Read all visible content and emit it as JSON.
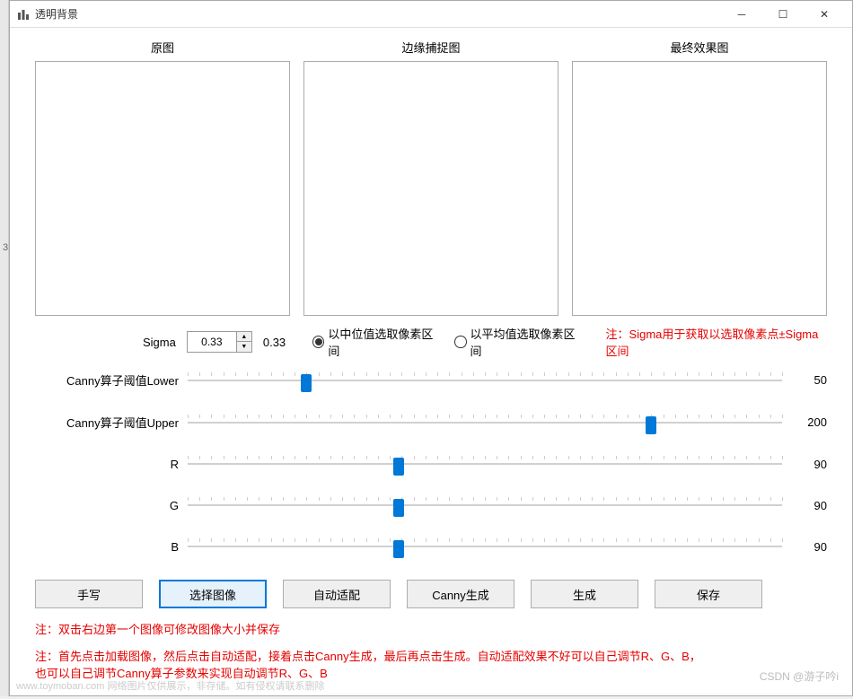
{
  "titlebar": {
    "title": "透明背景"
  },
  "left_strip": {
    "value": "3"
  },
  "images": {
    "original": "原图",
    "edge": "边缘捕捉图",
    "result": "最终效果图"
  },
  "sigma": {
    "label": "Sigma",
    "input_value": "0.33",
    "display_value": "0.33",
    "radio_median": "以中位值选取像素区间",
    "radio_mean": "以平均值选取像素区间",
    "note": "注：Sigma用于获取以选取像素点±Sigma区间"
  },
  "sliders": {
    "lower": {
      "label": "Canny算子阈值Lower",
      "value": "50",
      "pos_pct": 20
    },
    "upper": {
      "label": "Canny算子阈值Upper",
      "value": "200",
      "pos_pct": 78
    },
    "r": {
      "label": "R",
      "value": "90",
      "pos_pct": 35.5
    },
    "g": {
      "label": "G",
      "value": "90",
      "pos_pct": 35.5
    },
    "b": {
      "label": "B",
      "value": "90",
      "pos_pct": 35.5
    }
  },
  "buttons": {
    "handwrite": "手写",
    "select_image": "选择图像",
    "auto_fit": "自动适配",
    "canny_gen": "Canny生成",
    "generate": "生成",
    "save": "保存"
  },
  "notes": {
    "note1": "注：双击右边第一个图像可修改图像大小并保存",
    "note2": "注：首先点击加载图像，然后点击自动适配，接着点击Canny生成，最后再点击生成。自动适配效果不好可以自己调节R、G、B，\n也可以自己调节Canny算子参数来实现自动调节R、G、B"
  },
  "watermark": "CSDN @游子吟i",
  "footer_faint": "www.toymoban.com 网络图片仅供展示，非存储。如有侵权请联系删除"
}
